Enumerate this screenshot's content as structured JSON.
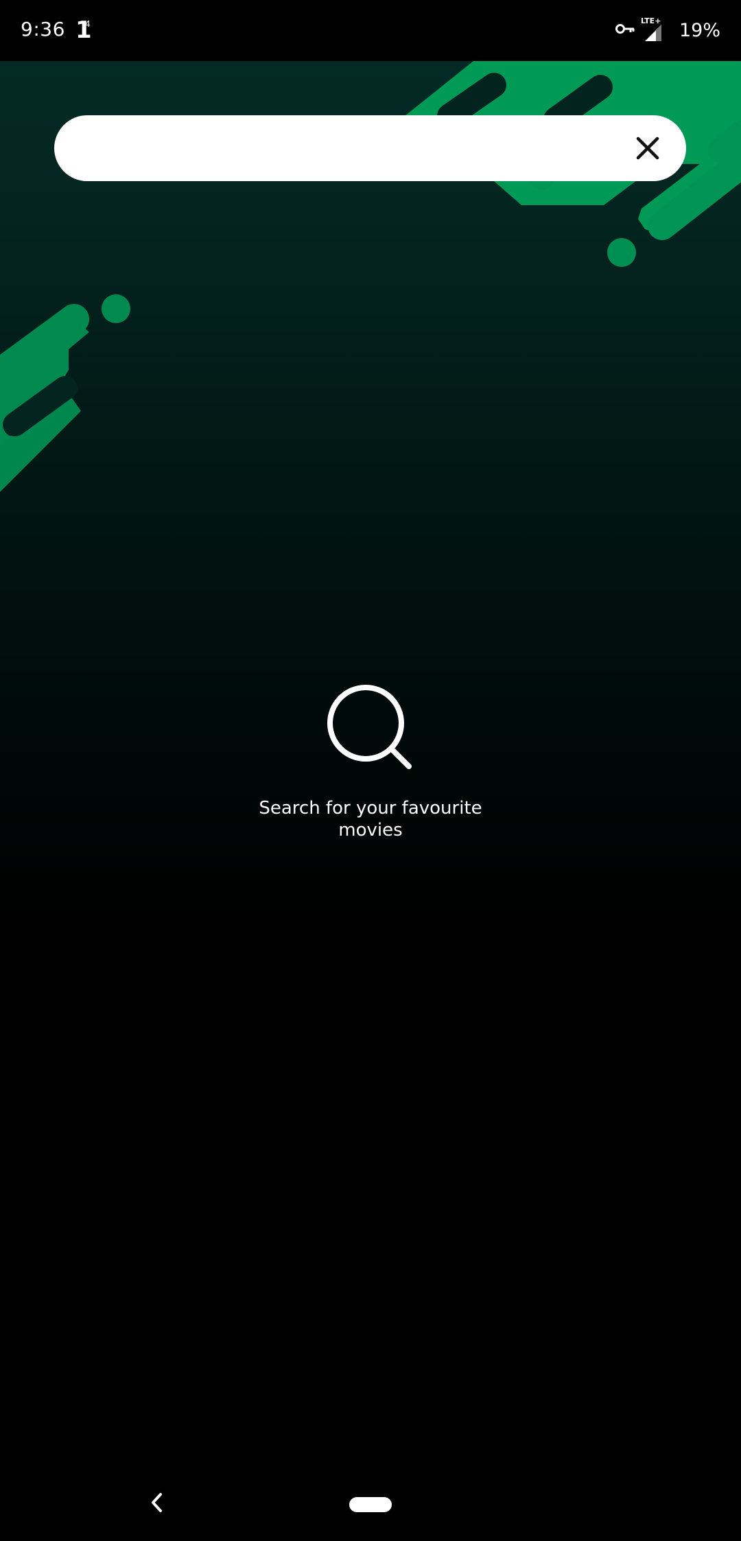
{
  "status_bar": {
    "time": "9:36",
    "notification_glyph": "1",
    "notification_superscript": "4",
    "network_label": "LTE+",
    "battery": "19%",
    "icons": [
      "vpn-key-icon",
      "signal-icon"
    ]
  },
  "search": {
    "value": "",
    "placeholder": "",
    "clear_icon": "close-icon"
  },
  "empty_state": {
    "icon": "search-icon",
    "message": "Search for your favourite movies"
  },
  "nav": {
    "back_icon": "chevron-left-icon",
    "home_icon": "home-pill-icon"
  },
  "colors": {
    "accent_green": "#00a85e",
    "background_top": "#042a25",
    "background": "#000000"
  }
}
